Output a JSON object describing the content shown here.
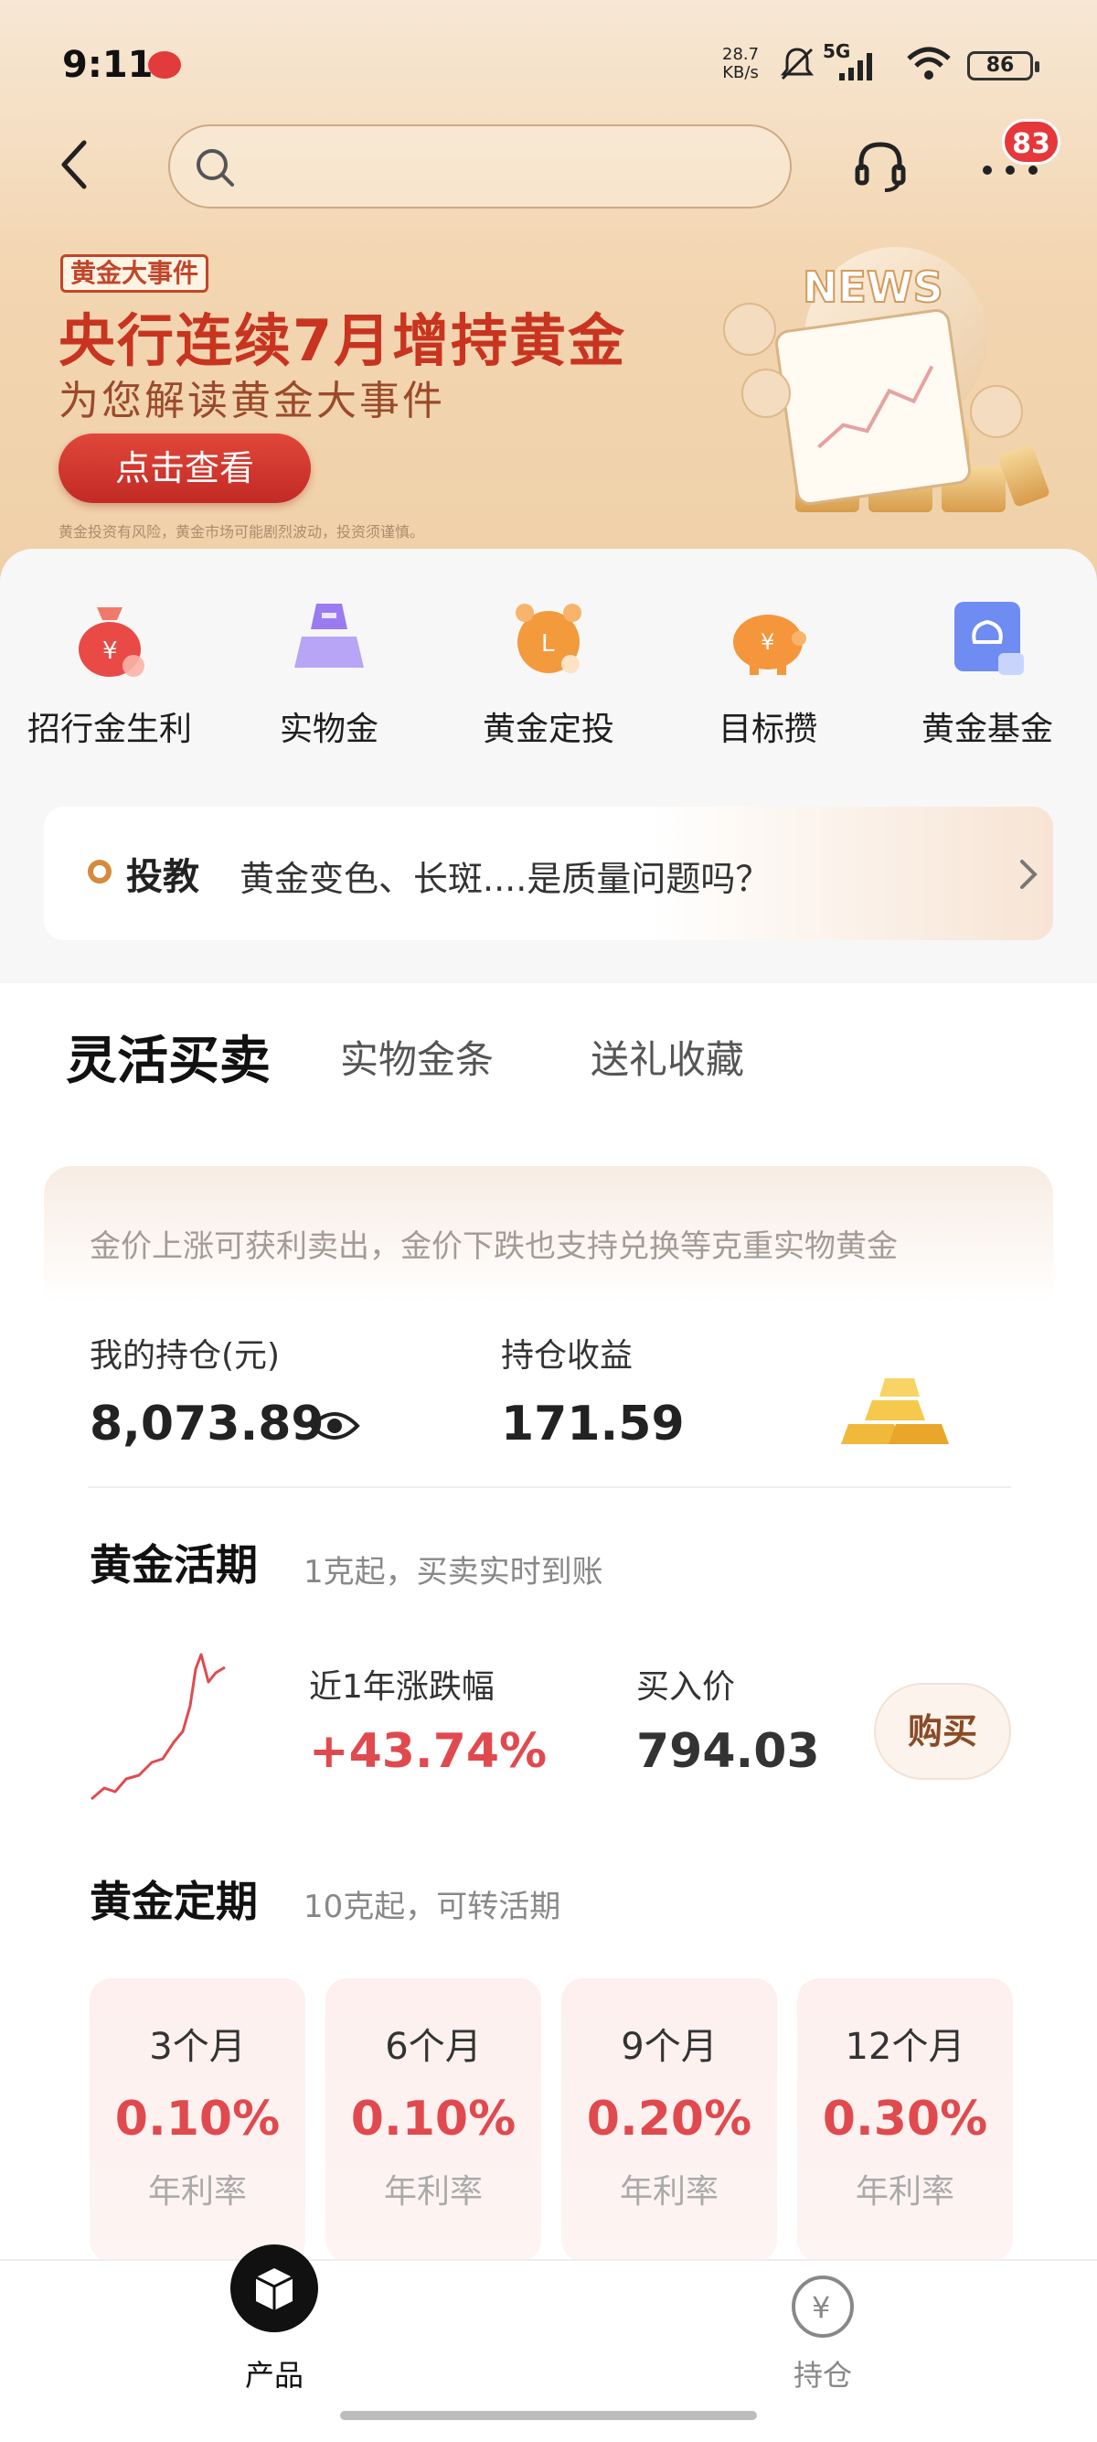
{
  "status_bar": {
    "time": "9:11",
    "net_speed_value": "28.7",
    "net_speed_unit": "KB/s",
    "network": "5G",
    "battery": "86"
  },
  "header": {
    "search_placeholder": "",
    "notification_count": "83"
  },
  "banner": {
    "tag": "黄金大事件",
    "headline": "央行连续7月增持黄金",
    "subline": "为您解读黄金大事件",
    "cta": "点击查看",
    "disclaimer": "黄金投资有风险，黄金市场可能剧烈波动，投资须谨慎。",
    "news_label": "NEWS"
  },
  "shortcuts": [
    {
      "label": "招行金生利",
      "icon": "money-bag-icon"
    },
    {
      "label": "实物金",
      "icon": "gold-bar-icon"
    },
    {
      "label": "黄金定投",
      "icon": "alarm-clock-icon"
    },
    {
      "label": "目标攒",
      "icon": "piggy-bank-icon"
    },
    {
      "label": "黄金基金",
      "icon": "fund-icon"
    }
  ],
  "tip": {
    "tag": "投教",
    "text": "黄金变色、长斑....是质量问题吗？"
  },
  "tabs": [
    {
      "label": "灵活买卖",
      "active": true
    },
    {
      "label": "实物金条",
      "active": false
    },
    {
      "label": "送礼收藏",
      "active": false
    }
  ],
  "card": {
    "description": "金价上涨可获利卖出，金价下跌也支持兑换等克重实物黄金",
    "holding_label": "我的持仓(元)",
    "holding_value": "8,073.89",
    "profit_label": "持仓收益",
    "profit_value": "171.59"
  },
  "demand": {
    "title": "黄金活期",
    "subtitle": "1克起，买卖实时到账",
    "change_label": "近1年涨跌幅",
    "change_value": "+43.74%",
    "price_label": "买入价",
    "price_value": "794.03",
    "buy_label": "购买"
  },
  "fixed": {
    "title": "黄金定期",
    "subtitle": "10克起，可转活期",
    "terms": [
      {
        "label": "3个月",
        "rate": "0.10%",
        "unit": "年利率"
      },
      {
        "label": "6个月",
        "rate": "0.10%",
        "unit": "年利率"
      },
      {
        "label": "9个月",
        "rate": "0.20%",
        "unit": "年利率"
      },
      {
        "label": "12个月",
        "rate": "0.30%",
        "unit": "年利率"
      }
    ]
  },
  "bottom_nav": [
    {
      "label": "产品",
      "active": true
    },
    {
      "label": "持仓",
      "active": false
    }
  ],
  "colors": {
    "accent_red": "#e04a4f",
    "brand_gold": "#d68a3b",
    "banner_red": "#c8341f"
  }
}
